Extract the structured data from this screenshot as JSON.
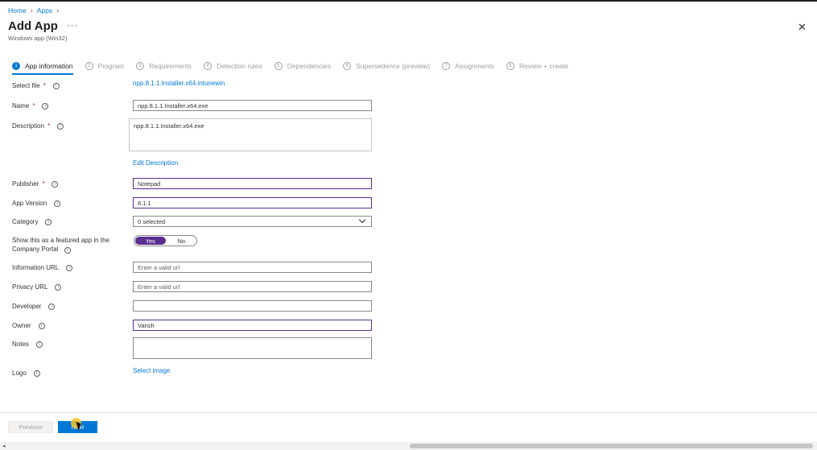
{
  "breadcrumb": {
    "home": "Home",
    "apps": "Apps",
    "sep": "›"
  },
  "header": {
    "title": "Add App",
    "subtitle": "Windows app (Win32)",
    "more": "···",
    "close": "✕"
  },
  "steps": [
    {
      "num": "1",
      "label": "App information"
    },
    {
      "num": "2",
      "label": "Program"
    },
    {
      "num": "3",
      "label": "Requirements"
    },
    {
      "num": "4",
      "label": "Detection rules"
    },
    {
      "num": "5",
      "label": "Dependencies"
    },
    {
      "num": "6",
      "label": "Supersedence (preview)"
    },
    {
      "num": "7",
      "label": "Assignments"
    },
    {
      "num": "8",
      "label": "Review + create"
    }
  ],
  "form": {
    "select_file_label": "Select file",
    "select_file_value": "npp.8.1.1.Installer.x64.intunewin",
    "name_label": "Name",
    "name_value": "npp.8.1.1.Installer.x64.exe",
    "description_label": "Description",
    "description_value": "npp.8.1.1.Installer.x64.exe",
    "edit_description": "Edit Description",
    "publisher_label": "Publisher",
    "publisher_value": "Notepad",
    "version_label": "App Version",
    "version_value": "8.1.1",
    "category_label": "Category",
    "category_value": "0 selected",
    "featured_label": "Show this as a featured app in the Company Portal",
    "featured_yes": "Yes",
    "featured_no": "No",
    "info_url_label": "Information URL",
    "info_url_placeholder": "Enter a valid url",
    "privacy_url_label": "Privacy URL",
    "privacy_url_placeholder": "Enter a valid url",
    "developer_label": "Developer",
    "developer_value": "",
    "owner_label": "Owner",
    "owner_value": "Vansh",
    "notes_label": "Notes",
    "logo_label": "Logo",
    "select_image": "Select image",
    "required_mark": "*",
    "info_glyph": "i"
  },
  "footer": {
    "previous": "Previous",
    "next": "Next"
  },
  "colors": {
    "accent": "#0078d4",
    "toggle": "#5c2d91",
    "required": "#a4262c"
  }
}
